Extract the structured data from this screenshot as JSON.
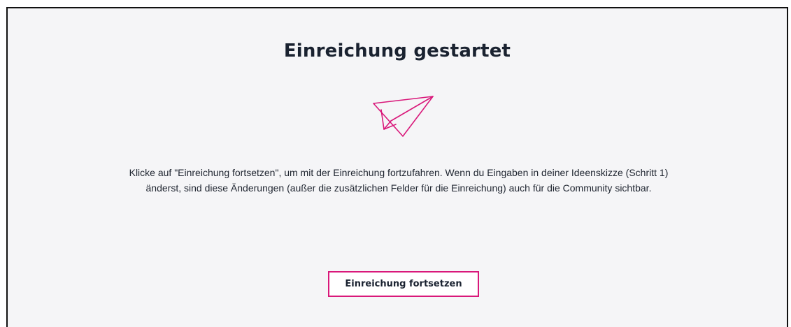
{
  "submission": {
    "title": "Einreichung gestartet",
    "icon": "paper-plane-icon",
    "description": "Klicke auf \"Einreichung fortsetzen\", um mit der Einreichung fortzufahren. Wenn du Eingaben in deiner Ideenskizze (Schritt 1) änderst, sind diese Änderungen (außer die zusätzlichen Felder für die Einreichung) auch für die Community sichtbar.",
    "continue_label": "Einreichung fortsetzen"
  },
  "colors": {
    "accent": "#d9187a",
    "text": "#1a2230",
    "panel_background": "#f5f5f7"
  }
}
